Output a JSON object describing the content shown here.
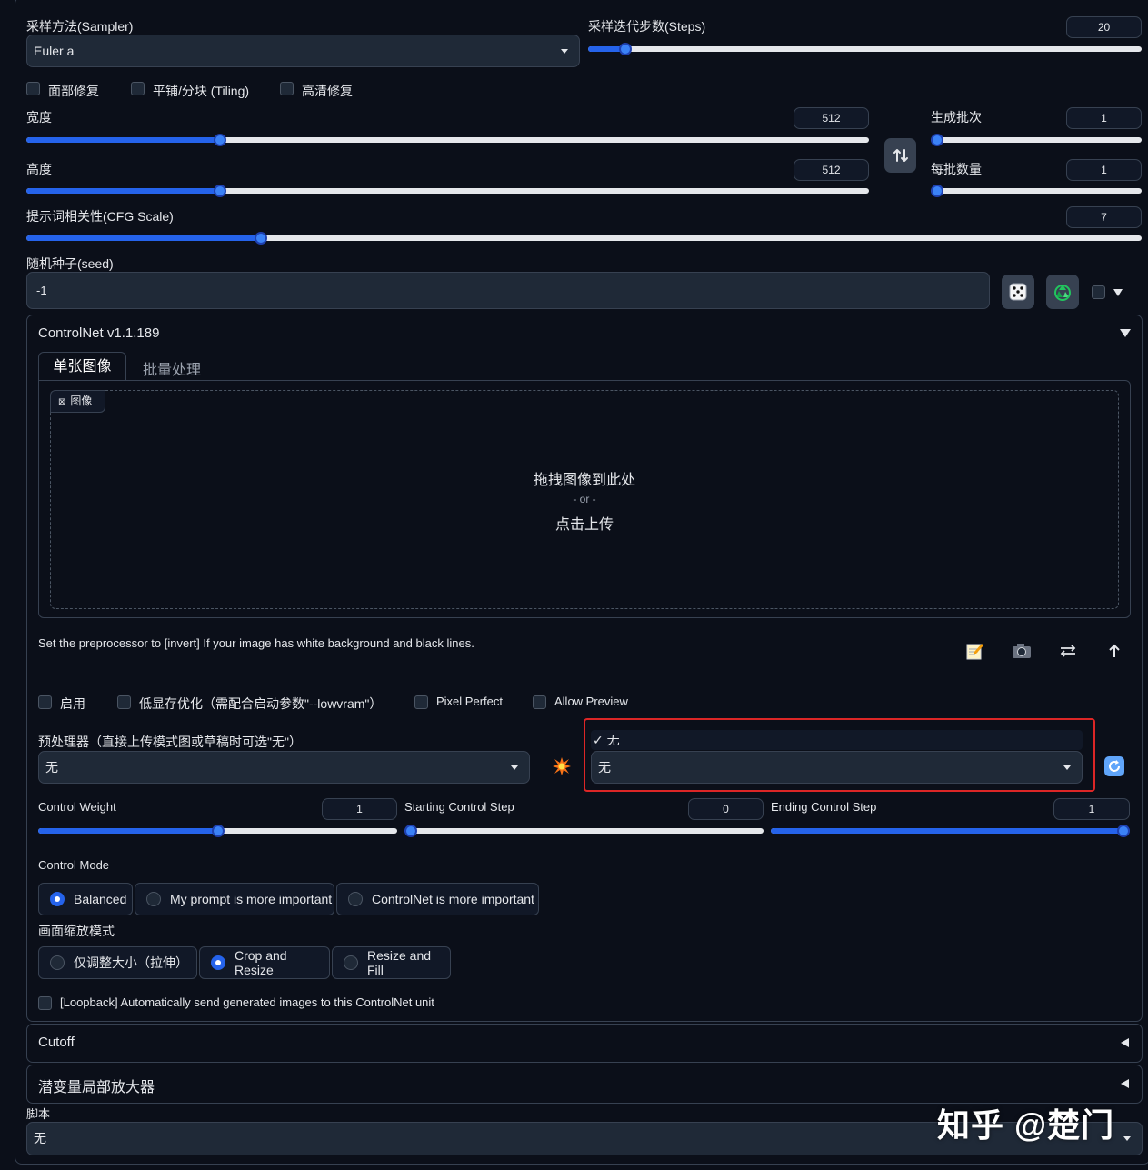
{
  "sampler": {
    "label": "采样方法(Sampler)",
    "value": "Euler a"
  },
  "steps": {
    "label": "采样迭代步数(Steps)",
    "value": "20",
    "fraction": 0.067
  },
  "options": {
    "face_restore": "面部修复",
    "tiling": "平铺/分块 (Tiling)",
    "hires_fix": "高清修复"
  },
  "width": {
    "label": "宽度",
    "value": "512",
    "fraction": 0.23
  },
  "height": {
    "label": "高度",
    "value": "512",
    "fraction": 0.23
  },
  "batch_count": {
    "label": "生成批次",
    "value": "1",
    "fraction": 0
  },
  "batch_size": {
    "label": "每批数量",
    "value": "1",
    "fraction": 0
  },
  "cfg": {
    "label": "提示词相关性(CFG Scale)",
    "value": "7",
    "fraction": 0.21
  },
  "seed": {
    "label": "随机种子(seed)",
    "value": "-1"
  },
  "controlnet": {
    "title": "ControlNet v1.1.189",
    "tabs": [
      "单张图像",
      "批量处理"
    ],
    "image_label": "图像",
    "drop_text": "拖拽图像到此处",
    "or_text": "- or -",
    "upload_text": "点击上传",
    "hint": "Set the preprocessor to [invert] If your image has white background and black lines.",
    "enable": "启用",
    "lowvram": "低显存优化（需配合启动参数\"--lowvram\"）",
    "pixel_perfect": "Pixel Perfect",
    "allow_preview": "Allow Preview",
    "preprocessor_label": "预处理器（直接上传模式图或草稿时可选\"无\"）",
    "preprocessor_value": "无",
    "model_dropdown_option": "无",
    "model_dropdown_checkmark": "✓",
    "model_value": "无",
    "control_weight": {
      "label": "Control Weight",
      "value": "1",
      "fraction": 0.5
    },
    "start_step": {
      "label": "Starting Control Step",
      "value": "0",
      "fraction": 0
    },
    "end_step": {
      "label": "Ending Control Step",
      "value": "1",
      "fraction": 1
    },
    "control_mode_label": "Control Mode",
    "control_modes": [
      "Balanced",
      "My prompt is more important",
      "ControlNet is more important"
    ],
    "resize_mode_label": "画面缩放模式",
    "resize_modes": [
      "仅调整大小（拉伸）",
      "Crop and Resize",
      "Resize and Fill"
    ],
    "loopback": "[Loopback] Automatically send generated images to this ControlNet unit"
  },
  "cutoff": {
    "title": "Cutoff"
  },
  "tiled": {
    "title": "潜变量局部放大器"
  },
  "script": {
    "label": "脚本",
    "value": "无"
  },
  "watermark": "知乎 @楚门",
  "colors": {
    "accent": "#2563eb",
    "background": "#0b0f19",
    "highlight_border": "#dc2626"
  },
  "icons": [
    "dice-icon",
    "recycle-icon",
    "swap-icon",
    "edit-icon",
    "camera-icon",
    "swap-horizontal-icon",
    "arrow-up-icon",
    "explosion-icon",
    "refresh-icon"
  ]
}
